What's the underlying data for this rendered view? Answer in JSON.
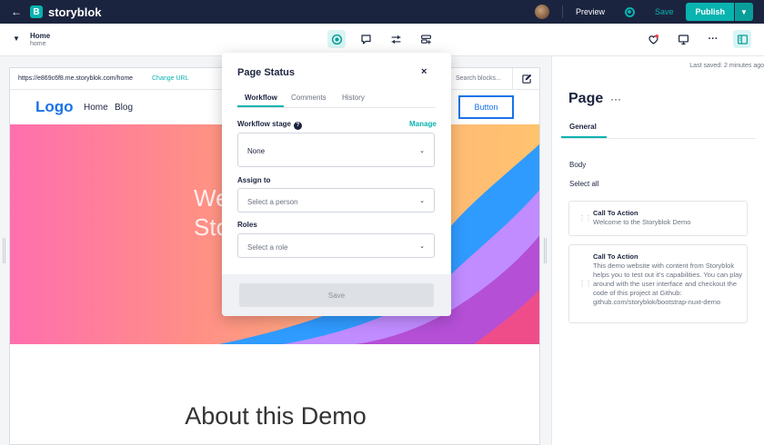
{
  "app": {
    "brand_letter": "B",
    "brand_name": "storyblok",
    "preview_label": "Preview",
    "save_label": "Save",
    "publish_label": "Publish",
    "accent_color": "#09b3af",
    "topbar_color": "#1b243f"
  },
  "story": {
    "title": "Home",
    "slug": "home"
  },
  "toolbar": {
    "center_icons": [
      "workflow-status-icon",
      "comment-icon",
      "settings-sliders-icon",
      "add-block-icon"
    ],
    "right_icons": [
      "heart-alert-icon",
      "desktop-preview-icon",
      "more-icon",
      "sidebar-toggle-icon"
    ],
    "more_label": "···"
  },
  "preview": {
    "url": "https://e869c6f8.me.storyblok.com/home",
    "change_url_label": "Change URL",
    "search_placeholder": "Search blocks...",
    "site": {
      "logo": "Logo",
      "nav": [
        "Home",
        "Blog"
      ],
      "button_label": "Button",
      "hero_line_1": "We",
      "hero_line_2": "Sto",
      "about_heading": "About this Demo"
    }
  },
  "popover": {
    "title": "Page Status",
    "close_label": "×",
    "tabs": [
      "Workflow",
      "Comments",
      "History"
    ],
    "active_tab": "Workflow",
    "workflow_stage_label": "Workflow stage",
    "manage_label": "Manage",
    "workflow_stage_value": "None",
    "assign_label": "Assign to",
    "assign_placeholder": "Select a person",
    "roles_label": "Roles",
    "roles_placeholder": "Select a role",
    "save_label": "Save"
  },
  "panel": {
    "last_saved": "Last saved: 2 minutes ago",
    "title": "Page",
    "menu_label": "···",
    "tab": "General",
    "body_label": "Body",
    "select_all": "Select all",
    "blocks": [
      {
        "title": "Call To Action",
        "description": "Welcome to the Storyblok Demo"
      },
      {
        "title": "Call To Action",
        "description": "This demo website with content from Storyblok helps you to test out it's capabilities. You can play around with the user interface and checkout the code of this project at Github: github.com/storyblok/bootstrap-nuxt-demo"
      }
    ]
  }
}
